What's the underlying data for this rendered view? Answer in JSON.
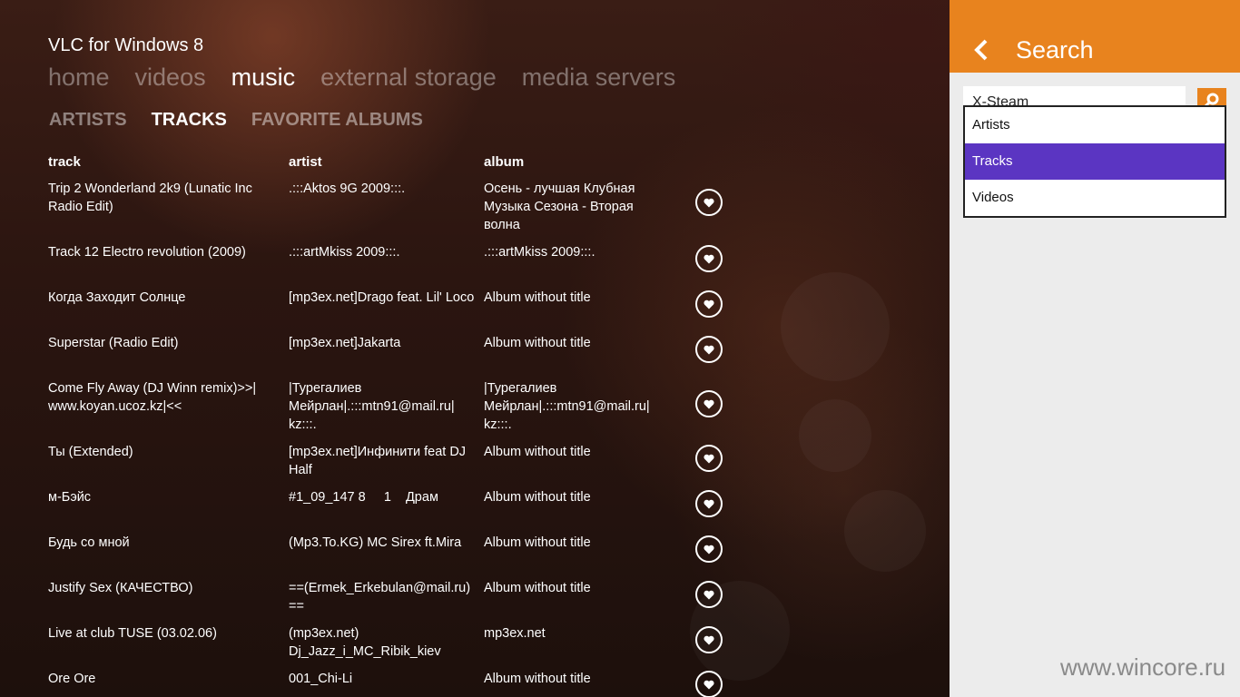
{
  "app": {
    "title": "VLC for Windows 8",
    "nav": [
      "home",
      "videos",
      "music",
      "external storage",
      "media servers"
    ],
    "subnav": [
      "ARTISTS",
      "TRACKS",
      "FAVORITE ALBUMS"
    ]
  },
  "table": {
    "headers": {
      "track": "track",
      "artist": "artist",
      "album": "album"
    },
    "rows": [
      {
        "track": "Trip 2 Wonderland 2k9 (Lunatic Inc Radio Edit)",
        "artist": ".:::Aktos 9G 2009:::.",
        "album": "Осень - лучшая Клубная Музыка Сезона - Вторая волна"
      },
      {
        "track": "Track 12 Electro revolution (2009)",
        "artist": ".:::artMkiss 2009:::.",
        "album": ".:::artMkiss 2009:::."
      },
      {
        "track": "Когда Заходит Солнце",
        "artist": "[mp3ex.net]Drago feat. Lil' Loco",
        "album": "Album without title"
      },
      {
        "track": "Superstar (Radio Edit)",
        "artist": "[mp3ex.net]Jakarta",
        "album": "Album without title"
      },
      {
        "track": "Come Fly Away (DJ Winn remix)>>|www.koyan.ucoz.kz|<<",
        "artist": "|Турегалиев Мейрлан|.:::mtn91@mail.ru| kz:::.",
        "album": "|Турегалиев Мейрлан|.:::mtn91@mail.ru| kz:::."
      },
      {
        "track": "Ты (Extended)",
        "artist": "[mp3ex.net]Инфинити feat DJ Half",
        "album": "Album without title"
      },
      {
        "track": "м-Бэйс",
        "artist": "#1_09_147 8     1    Драм",
        "album": "Album without title"
      },
      {
        "track": "Будь со мной",
        "artist": "(Mp3.To.KG) MC Sirex ft.Mira",
        "album": "Album without title"
      },
      {
        "track": "Justify Sex (КАЧЕСТВО)",
        "artist": "==(Ermek_Erkebulan@mail.ru) ==",
        "album": "Album without title"
      },
      {
        "track": "Live at club TUSE (03.02.06)",
        "artist": "(mp3ex.net) Dj_Jazz_i_MC_Ribik_kiev",
        "album": "mp3ex.net"
      },
      {
        "track": "Ore Ore",
        "artist": "001_Chi-Li",
        "album": "Album without title"
      }
    ]
  },
  "search": {
    "title": "Search",
    "query": "X-Steam",
    "options": [
      "Artists",
      "Tracks",
      "Videos"
    ]
  },
  "watermark": "www.wincore.ru",
  "colors": {
    "accent": "#e8831e",
    "selection": "#5b35c2",
    "pane": "#ececec"
  },
  "icons": {
    "back": "chevron-left-icon",
    "heart": "heart-icon",
    "search": "magnifier-icon"
  }
}
